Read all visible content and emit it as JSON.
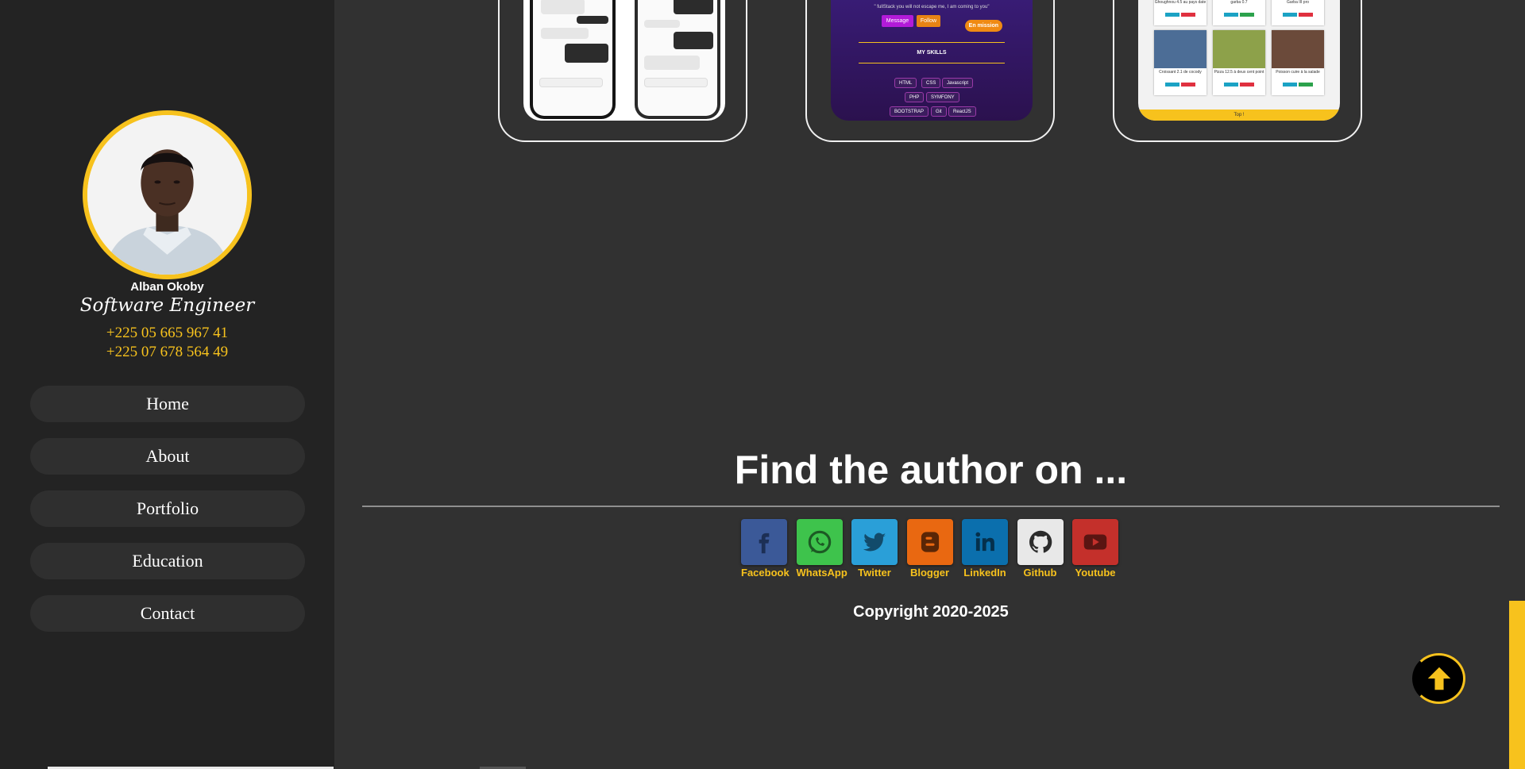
{
  "profile": {
    "name": "Alban Okoby",
    "role": "Software Engineer",
    "phones": [
      "+225 05 665 967 41",
      "+225 07 678 564 49"
    ]
  },
  "nav": {
    "items": [
      {
        "label": "Home"
      },
      {
        "label": "About"
      },
      {
        "label": "Portfolio"
      },
      {
        "label": "Education"
      },
      {
        "label": "Contact"
      }
    ]
  },
  "projects": {
    "skills_card": {
      "quote": "\" fullStack you will not escape me, I am coming to you\"",
      "message_label": "Message",
      "follow_label": "Follow",
      "badge": "En mission",
      "heading": "MY SKILLS",
      "skills": [
        "HTML",
        "CSS",
        "Javascript",
        "PHP",
        "SYMFONY",
        "BOOTSTRAP",
        "Git",
        "ReactJS"
      ]
    },
    "food_card": {
      "items": [
        "Ghoughnou 4.5 au pays date",
        "garba 0.7",
        "Garba III pro",
        "Croissant 2.1 de cocody",
        "Pizza 12.5 à deux cent point",
        "Poisson cuire à la salade"
      ],
      "footer": "Top !"
    }
  },
  "footer": {
    "heading": "Find the author on ...",
    "socials": [
      {
        "label": "Facebook",
        "icon": "facebook-icon",
        "color": "#3b5998"
      },
      {
        "label": "WhatsApp",
        "icon": "whatsapp-icon",
        "color": "#3ec34c"
      },
      {
        "label": "Twitter",
        "icon": "twitter-icon",
        "color": "#2a9fd8"
      },
      {
        "label": "Blogger",
        "icon": "blogger-icon",
        "color": "#e96811"
      },
      {
        "label": "LinkedIn",
        "icon": "linkedin-icon",
        "color": "#0b6fad"
      },
      {
        "label": "Github",
        "icon": "github-icon",
        "color": "#e8e8e8"
      },
      {
        "label": "Youtube",
        "icon": "youtube-icon",
        "color": "#c4302b"
      }
    ],
    "copyright": "Copyright 2020-2025"
  },
  "colors": {
    "accent": "#f7c21d",
    "sidebar": "#232323",
    "main": "#313131"
  }
}
